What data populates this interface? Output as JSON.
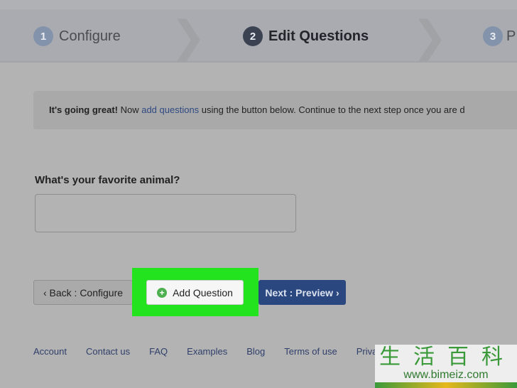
{
  "steps": [
    {
      "num": "1",
      "label": "Configure"
    },
    {
      "num": "2",
      "label": "Edit Questions"
    },
    {
      "num": "3",
      "label": "P"
    }
  ],
  "alert": {
    "bold": "It's going great!",
    "pre": " Now ",
    "link": "add questions",
    "post": " using the button below. Continue to the next step once you are d"
  },
  "question": {
    "label": "What's your favorite animal?",
    "value": ""
  },
  "buttons": {
    "back": "‹ Back : Configure",
    "add": "Add Question",
    "next": "Next : Preview ›"
  },
  "footer": [
    "Account",
    "Contact us",
    "FAQ",
    "Examples",
    "Blog",
    "Terms of use",
    "Privacy"
  ],
  "watermark": {
    "chars": "生活百科",
    "url": "www.bimeiz.com"
  },
  "colors": {
    "highlight": "#23e31f",
    "primary": "#2b4780",
    "link": "#2f4a82"
  }
}
